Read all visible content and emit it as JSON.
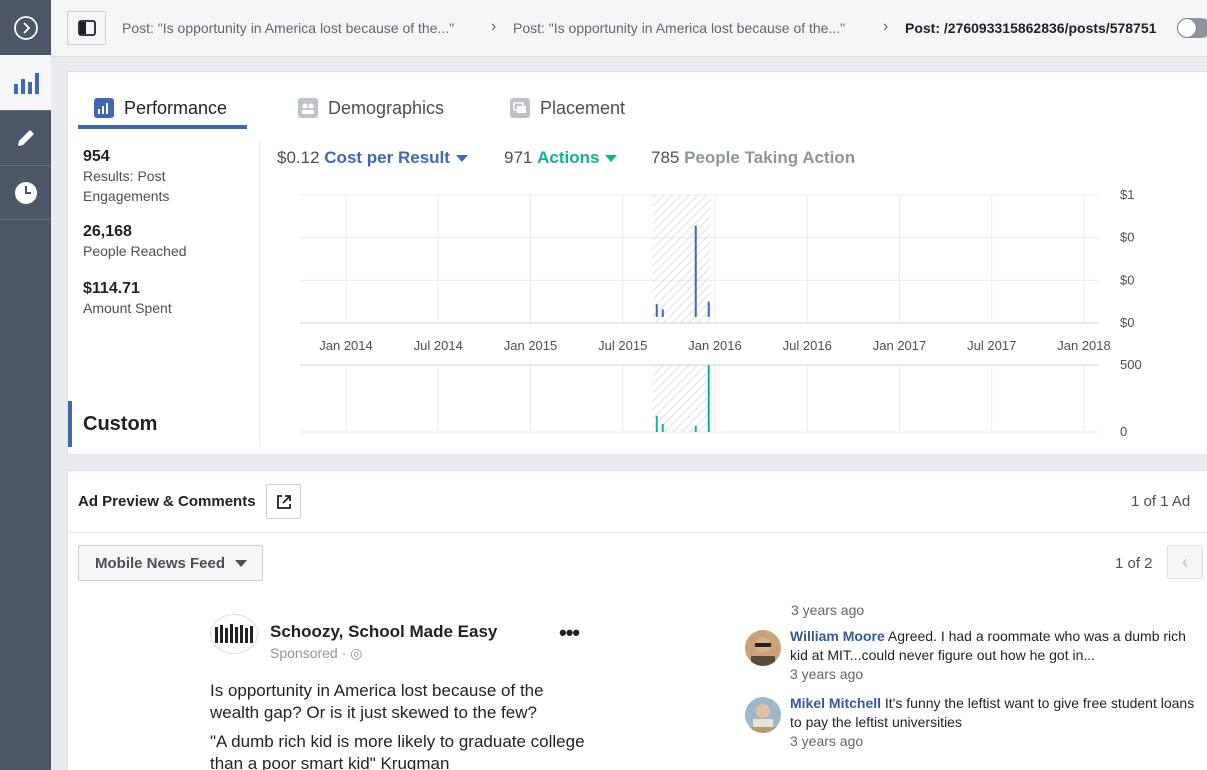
{
  "breadcrumb": {
    "crumb1": "Post: \"Is opportunity in America lost because of the...\"",
    "crumb2": "Post: \"Is opportunity in America lost because of the...\"",
    "crumb3": "Post: /276093315862836/posts/578751"
  },
  "tabs": {
    "performance": "Performance",
    "demographics": "Demographics",
    "placement": "Placement"
  },
  "metrics": [
    {
      "value": "954",
      "label": "Results: Post Engagements"
    },
    {
      "value": "26,168",
      "label": "People Reached"
    },
    {
      "value": "$114.71",
      "label": "Amount Spent"
    }
  ],
  "custom_label": "Custom",
  "chart_header": {
    "cost_value": "$0.12",
    "cost_label": "Cost per Result",
    "actions_value": "971",
    "actions_label": "Actions",
    "people_value": "785",
    "people_label": "People Taking Action"
  },
  "chart_data": [
    {
      "type": "line",
      "title": "Cost per Result",
      "x_ticks": [
        "Jan 2014",
        "Jul 2014",
        "Jan 2015",
        "Jul 2015",
        "Jan 2016",
        "Jul 2016",
        "Jan 2017",
        "Jul 2017",
        "Jan 2018"
      ],
      "y_ticks": [
        "$1",
        "$0",
        "$0",
        "$0"
      ],
      "series": [
        {
          "values": [
            0,
            0.25,
            0.15,
            0.85,
            0.3
          ]
        }
      ],
      "color": "#4267b2"
    },
    {
      "type": "line",
      "title": "Actions",
      "y_ticks": [
        "500",
        "0"
      ],
      "series": [
        {
          "values": [
            0,
            120,
            60,
            30,
            500
          ]
        }
      ],
      "color": "#10b293"
    }
  ],
  "ad_preview": {
    "title": "Ad Preview & Comments",
    "count": "1 of 1 Ad",
    "placement": "Mobile News Feed",
    "page_count": "1 of 2"
  },
  "post": {
    "page_name": "Schoozy, School Made Easy",
    "sponsored": "Sponsored · ",
    "text1": "Is opportunity in America lost because of the wealth gap? Or is it just skewed to the few?",
    "text2": "\"A dumb rich kid is more likely to graduate college than a poor smart kid\" Krugman"
  },
  "comments": {
    "first_time": "3 years ago",
    "items": [
      {
        "name": "William Moore",
        "text": "Agreed. I had a roommate who was a dumb rich kid at MIT...could never figure out how he got in...",
        "time": "3 years ago"
      },
      {
        "name": "Mikel Mitchell",
        "text": "It's funny the leftist want to give free student loans to pay the leftist universities",
        "time": "3 years ago"
      }
    ]
  },
  "colors": {
    "accent": "#4267b2",
    "green": "#10b293",
    "rail": "#4b5669"
  }
}
